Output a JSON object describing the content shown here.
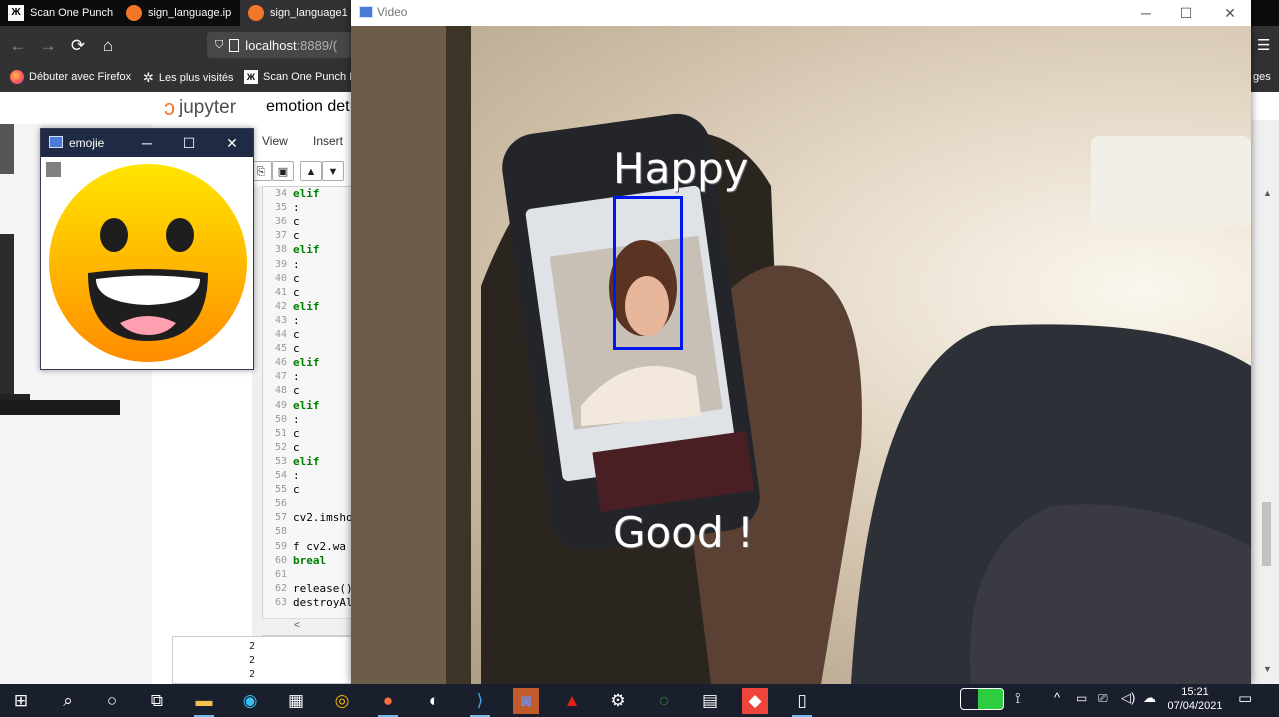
{
  "browser": {
    "tabs": [
      {
        "label": "Scan One Punch",
        "icon": "manga-icon"
      },
      {
        "label": "sign_language.ip",
        "icon": "jupyter-icon"
      },
      {
        "label": "sign_language1",
        "icon": "jupyter-icon"
      }
    ],
    "url": {
      "host": "localhost",
      "port": ":8889/("
    },
    "bookmarks": [
      {
        "label": "Débuter avec Firefox",
        "icon": "firefox-icon"
      },
      {
        "label": "Les plus visités",
        "icon": "gear-icon"
      },
      {
        "label": "Scan One Punch M",
        "icon": "manga-icon"
      }
    ],
    "bookmarks_overflow": "ges"
  },
  "jupyter": {
    "logo_text": "jupyter",
    "notebook_title": "emotion det",
    "menu": [
      "View",
      "Insert"
    ],
    "line_numbers": [
      "34",
      "35",
      "36",
      "37",
      "38",
      "39",
      "40",
      "41",
      "42",
      "43",
      "44",
      "45",
      "46",
      "47",
      "48",
      "49",
      "50",
      "51",
      "52",
      "53",
      "54",
      "55",
      "56",
      "57",
      "58",
      "59",
      "60",
      "61",
      "62",
      "63"
    ],
    "code_lines": [
      {
        "ln": "34",
        "text": "elif",
        "kw": true
      },
      {
        "ln": "35",
        "text": "    :",
        "kw": false
      },
      {
        "ln": "36",
        "text": "    c",
        "kw": false
      },
      {
        "ln": "37",
        "text": "    c",
        "kw": false
      },
      {
        "ln": "38",
        "text": "elif",
        "kw": true
      },
      {
        "ln": "39",
        "text": "    :",
        "kw": false
      },
      {
        "ln": "40",
        "text": "    c",
        "kw": false
      },
      {
        "ln": "41",
        "text": "    c",
        "kw": false
      },
      {
        "ln": "42",
        "text": "elif",
        "kw": true
      },
      {
        "ln": "43",
        "text": "    :",
        "kw": false
      },
      {
        "ln": "44",
        "text": "    c",
        "kw": false
      },
      {
        "ln": "45",
        "text": "    c",
        "kw": false
      },
      {
        "ln": "46",
        "text": "elif",
        "kw": true
      },
      {
        "ln": "47",
        "text": "    :",
        "kw": false
      },
      {
        "ln": "48",
        "text": "    c",
        "kw": false
      },
      {
        "ln": "49",
        "text": "elif",
        "kw": true
      },
      {
        "ln": "50",
        "text": "    :",
        "kw": false
      },
      {
        "ln": "51",
        "text": "    c",
        "kw": false
      },
      {
        "ln": "52",
        "text": "    c",
        "kw": false
      },
      {
        "ln": "53",
        "text": "elif",
        "kw": true
      },
      {
        "ln": "54",
        "text": "    :",
        "kw": false
      },
      {
        "ln": "55",
        "text": "    c",
        "kw": false
      },
      {
        "ln": "56",
        "text": "",
        "kw": false
      },
      {
        "ln": "57",
        "text": "cv2.imsho",
        "kw": false
      },
      {
        "ln": "58",
        "text": "",
        "kw": false
      },
      {
        "ln": "59",
        "text": "f cv2.wa",
        "kw": false
      },
      {
        "ln": "60",
        "text": "  breal",
        "kw": true
      },
      {
        "ln": "61",
        "text": "",
        "kw": false
      },
      {
        "ln": "62",
        "text": "release()",
        "kw": false
      },
      {
        "ln": "63",
        "text": "destroyAl",
        "kw": false
      }
    ],
    "output_lines": [
      "2",
      "2",
      "2"
    ]
  },
  "emoji_window": {
    "title": "emojie",
    "emoji": "grinning-face",
    "colors": {
      "face_top": "#ffe500",
      "face_bottom": "#ff8c00",
      "mouth": "#1e1e1e",
      "tongue": "#ff9fb0"
    }
  },
  "video_window": {
    "title": "Video",
    "emotion_label": "Happy",
    "feedback_label": "Good !",
    "box_color": "#0018f0"
  },
  "taskbar": {
    "icons": [
      "windows-start-icon",
      "search-icon",
      "cortana-icon",
      "task-view-icon",
      "file-explorer-icon",
      "edge-icon",
      "store-icon",
      "chrome-icon",
      "firefox-icon",
      "github-icon",
      "vscode-icon",
      "discord-icon",
      "acrobat-icon",
      "settings-icon",
      "anaconda-icon",
      "network-drive-icon",
      "anydesk-icon",
      "notepad-icon"
    ],
    "time": "15:21",
    "date": "07/04/2021"
  }
}
